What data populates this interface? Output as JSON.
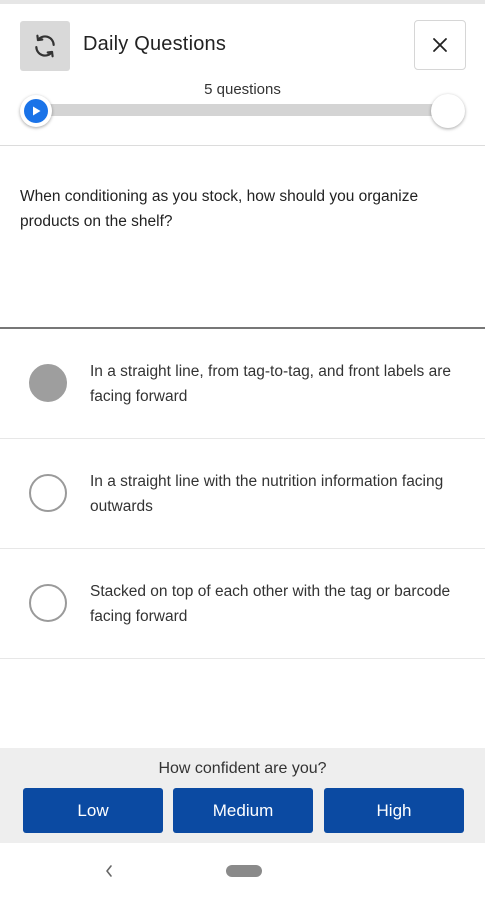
{
  "header": {
    "title": "Daily Questions",
    "refresh_icon": "refresh-icon",
    "close_icon": "close-icon"
  },
  "progress": {
    "label": "5 questions",
    "current": 0,
    "total": 5,
    "accent_color": "#1a73e8"
  },
  "question": {
    "text": "When conditioning as you stock, how should you organize products on the shelf?"
  },
  "options": [
    {
      "text": "In a straight line, from tag-to-tag, and front labels are facing forward",
      "selected": true
    },
    {
      "text": "In a straight line with the nutrition information facing outwards",
      "selected": false
    },
    {
      "text": "Stacked on top of each other with the tag or barcode facing forward",
      "selected": false
    }
  ],
  "confidence": {
    "label": "How confident are you?",
    "buttons": [
      "Low",
      "Medium",
      "High"
    ],
    "button_color": "#0b4aa2"
  },
  "nav": {
    "back_icon": "back-chevron-icon",
    "home_icon": "home-pill-icon"
  }
}
